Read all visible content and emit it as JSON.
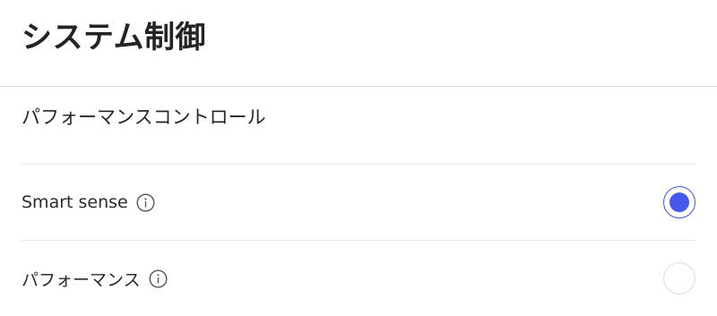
{
  "header": {
    "title": "システム制御"
  },
  "section": {
    "title": "パフォーマンスコントロール"
  },
  "options": [
    {
      "label": "Smart sense",
      "info_icon": "info-circle-icon",
      "selected": true
    },
    {
      "label": "パフォーマンス",
      "info_icon": "info-circle-icon",
      "selected": false
    }
  ],
  "colors": {
    "accent": "#4657ec",
    "header_divider": "#d6d9ee",
    "row_divider": "#ebebee",
    "radio_unselected_border": "#dcdce2"
  }
}
